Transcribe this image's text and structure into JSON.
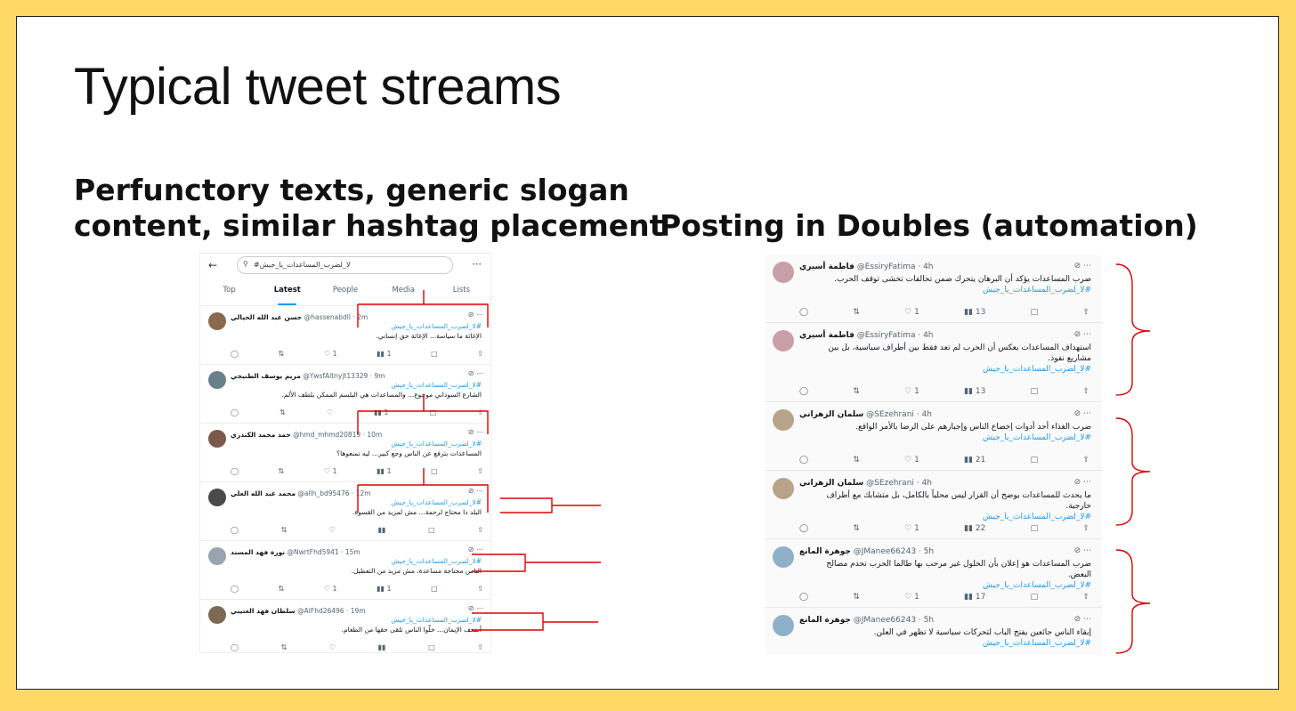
{
  "slide": {
    "title": "Typical tweet streams",
    "subtitle_left": "Perfunctory texts, generic slogan content, similar hashtag placement",
    "subtitle_left_line1": "Perfunctory texts, generic slogan",
    "subtitle_left_line2": "content, similar hashtag placement",
    "subtitle_right": "Posting in Doubles (automation)"
  },
  "colors": {
    "background": "#FFD966",
    "accent": "#1d9bf0",
    "annotation": "#e00000"
  },
  "left_screenshot": {
    "search_query": "#لا_لضرب_المساعدات_يا_جيش",
    "tabs": [
      "Top",
      "Latest",
      "People",
      "Media",
      "Lists"
    ],
    "active_tab": "Latest",
    "tweets": [
      {
        "name": "حسن عبد الله الحيالي",
        "handle": "@hassenabdll · 2m",
        "hashtag": "#لا_لضرب_المساعدات_يا_جيش",
        "text": "الإغاثة ما سياسة... الإغاثة حق إنساني.",
        "likes": "1",
        "views": "1"
      },
      {
        "name": "مريم يوسف الطنيجي",
        "handle": "@YwsfAltnyjt13329 · 9m",
        "hashtag": "#لا_لضرب_المساعدات_يا_جيش",
        "text": "الشارع السوداني موجوع... والمساعدات هي البلسم الممكن بلطف الألم.",
        "likes": "",
        "views": "1"
      },
      {
        "name": "حمد محمد الكندري",
        "handle": "@hmd_mhmd20819 · 10m",
        "hashtag": "#لا_لضرب_المساعدات_يا_جيش",
        "text": "المساعدات بترفع عن الناس وجع كبير... ليه تمنعوها؟",
        "likes": "1",
        "views": "1"
      },
      {
        "name": "محمد عبد الله العلي",
        "handle": "@allh_bd95476 · 12m",
        "hashtag": "#لا_لضرب_المساعدات_يا_جيش",
        "text": "البلد دا محتاج لرحمة... مش لمزيد من القسوة.",
        "likes": "",
        "views": ""
      },
      {
        "name": "نورة فهد المسند",
        "handle": "@NwrtFhd5941 · 15m",
        "hashtag": "#لا_لضرب_المساعدات_يا_جيش",
        "text": "الناس محتاجة مساعدة، مش مزيد من التعطيل.",
        "likes": "1",
        "views": "1"
      },
      {
        "name": "سلطان فهد العتيبي",
        "handle": "@AlFhd26496 · 19m",
        "hashtag": "#لا_لضرب_المساعدات_يا_جيش",
        "text": "أضعف الإيمان... خلّوا الناس تلقى حقها من الطعام.",
        "likes": "",
        "views": ""
      }
    ]
  },
  "right_screenshot": {
    "tweets": [
      {
        "name": "فاطمة أسيري",
        "handle": "@EssiryFatima · 4h",
        "text": "ضرب المساعدات يؤكد أن البرهان يتحرك ضمن تحالفات تخشى توقف الحرب.",
        "hashtag": "#لا_لضرب_المساعدات_يا_جيش",
        "likes": "1",
        "views": "13"
      },
      {
        "name": "فاطمة أسيري",
        "handle": "@EssiryFatima · 4h",
        "text": "استهداف المساعدات يعكس أن الحرب لم تعد فقط بين أطراف سياسية، بل بين مشاريع نفوذ.",
        "hashtag": "#لا_لضرب_المساعدات_يا_جيش",
        "likes": "1",
        "views": "13"
      },
      {
        "name": "سلمان الزهراني",
        "handle": "@SEzehrani · 4h",
        "text": "ضرب الغذاء أحد أدوات إخضاع الناس وإجبارهم على الرضا بالأمر الواقع.",
        "hashtag": "#لا_لضرب_المساعدات_يا_جيش",
        "likes": "1",
        "views": "21"
      },
      {
        "name": "سلمان الزهراني",
        "handle": "@SEzehrani · 4h",
        "text": "ما يحدث للمساعدات يوضح أن القرار ليس محلياً بالكامل، بل متشابك مع أطراف خارجية.",
        "hashtag": "#لا_لضرب_المساعدات_يا_جيش",
        "likes": "1",
        "views": "22"
      },
      {
        "name": "جوهرة المانع",
        "handle": "@JManee66243 · 5h",
        "text": "ضرب المساعدات هو إعلان بأن الحلول غير مرحب بها طالما الحرب تخدم مصالح البعض.",
        "hashtag": "#لا_لضرب_المساعدات_يا_جيش",
        "likes": "1",
        "views": "17"
      },
      {
        "name": "جوهرة المانع",
        "handle": "@JManee66243 · 5h",
        "text": "إبقاء الناس جائعين يفتح الباب لتحركات سياسية لا تظهر في العلن.",
        "hashtag": "#لا_لضرب_المساعدات_يا_جيش",
        "likes": "",
        "views": ""
      }
    ]
  }
}
